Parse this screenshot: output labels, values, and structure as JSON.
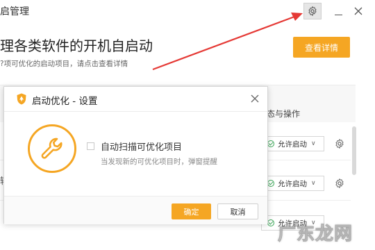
{
  "window": {
    "title": "启管理",
    "heading": "理各类软件的开机自启动",
    "subtitle": "?项可优化的启动项目，请点击查看详情",
    "detail_button": "查看详情",
    "status_column_header": "态与操作",
    "rows": [
      {
        "status": "允许启动",
        "side_char": ""
      },
      {
        "status": "允许启动",
        "side_char": "输"
      },
      {
        "status": "允许启动",
        "side_char": ""
      }
    ]
  },
  "dialog": {
    "title": "启动优化 - 设置",
    "option_label": "自动扫描可优化项目",
    "option_checked": false,
    "option_description": "当发现新的可优化项目时，弹窗提醒",
    "ok_label": "确定",
    "cancel_label": "取消"
  },
  "watermark": "广东龙网",
  "colors": {
    "accent": "#f5a623",
    "annotation_arrow": "#e53935",
    "status_green": "#3aa757"
  },
  "icons": {
    "title_settings": "gear-icon",
    "minimize": "minimize-icon",
    "close": "close-icon",
    "dialog_logo": "shield-logo-icon",
    "dialog_feature": "wrench-icon",
    "row_settings": "gear-icon"
  }
}
